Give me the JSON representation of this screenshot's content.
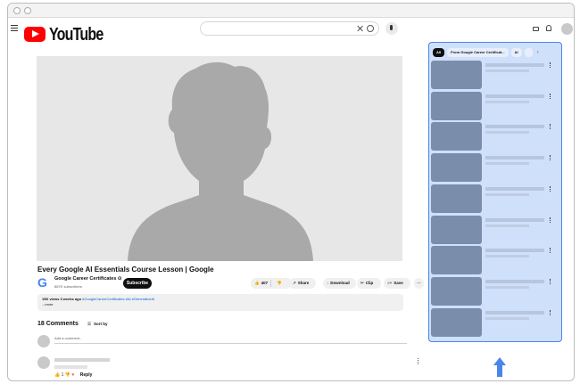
{
  "header": {
    "logo_text": "YouTube"
  },
  "video": {
    "title": "Every Google AI Essentials Course Lesson | Google",
    "channel_logo": "G",
    "channel_name": "Google Career Certificates ⊙",
    "subscribers": "887K subscribers",
    "subscribe_label": "Subscribe",
    "likes": "407",
    "share_label": "Share",
    "download_label": "Download",
    "clip_label": "Clip",
    "save_label": "Save",
    "more_label": "···"
  },
  "description": {
    "meta": "15K views 3 weeks ago",
    "tags": "#GoogleCareerCertificates #AI #GenerativeAI",
    "more": "...more"
  },
  "comments": {
    "count_label": "18 Comments",
    "sort_label": "Sort by",
    "add_placeholder": "Add a comment...",
    "reply_label": "Reply",
    "like_count": "1"
  },
  "sidebar": {
    "chips": [
      "All",
      "From Google Career Certificat...",
      "AI"
    ],
    "recommendations": 9
  },
  "colors": {
    "highlight_fill": "#cfe0fb",
    "highlight_border": "#4a86e8",
    "brand_red": "#ff0000"
  }
}
